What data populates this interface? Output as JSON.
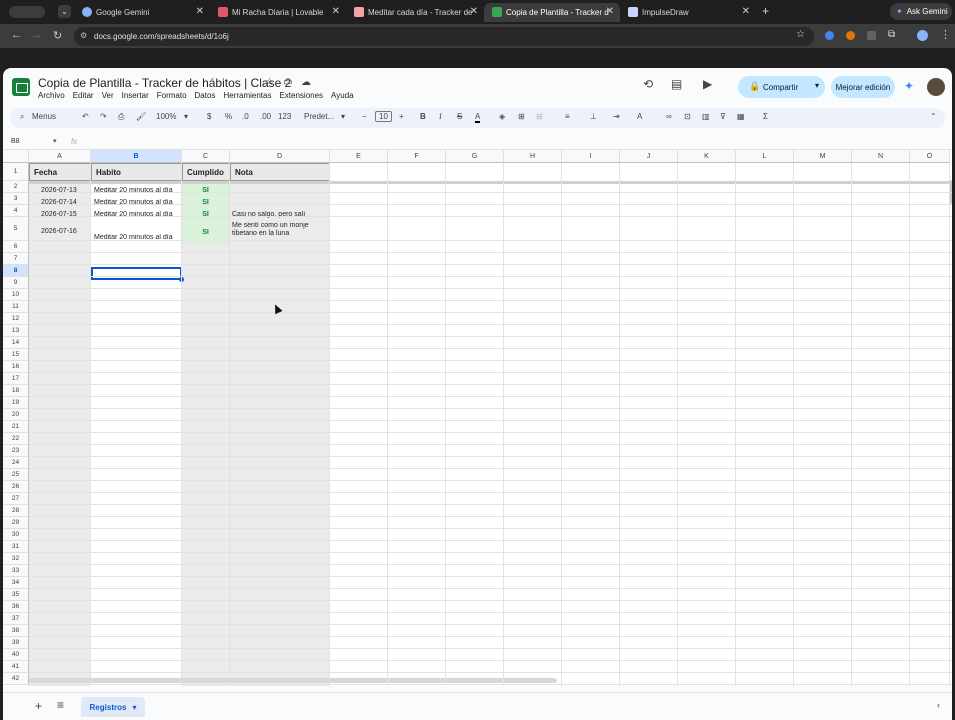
{
  "browser": {
    "tabs": [
      {
        "label": "Google Gemini",
        "color": "#8ab4f8"
      },
      {
        "label": "Mi Racha Diaria | Lovable",
        "color": "#e2566e"
      },
      {
        "label": "Meditar cada día - Tracker de",
        "color": "#f4a3a8"
      },
      {
        "label": "Copia de Plantilla - Tracker d",
        "color": "#34a853"
      },
      {
        "label": "ImpulseDraw",
        "color": "#c9d5ff"
      }
    ],
    "ask_gemini": "Ask Gemini",
    "url": "docs.google.com/spreadsheets/d/1o6j"
  },
  "doc": {
    "title": "Copia de Plantilla - Tracker de hábitos | Clase 2",
    "menu": [
      "Archivo",
      "Editar",
      "Ver",
      "Insertar",
      "Formato",
      "Datos",
      "Herramientas",
      "Extensiones",
      "Ayuda"
    ],
    "share_label": "Compartir",
    "improve_label": "Mejorar edición"
  },
  "toolbar": {
    "menus_label": "Menus",
    "zoom": "100%",
    "currency": "$",
    "percent": "%",
    "dec_minus": ".0",
    "dec_plus": ".00",
    "format_123": "123",
    "font": "Predet...",
    "font_size": "10",
    "bold": "B",
    "italic": "I",
    "strike": "S",
    "text_color": "A"
  },
  "formula": {
    "cell_ref": "B8",
    "fx": "fx"
  },
  "grid": {
    "columns": [
      "A",
      "B",
      "C",
      "D",
      "E",
      "F",
      "G",
      "H",
      "I",
      "J",
      "K",
      "L",
      "M",
      "N",
      "O"
    ],
    "rows": [
      "1",
      "2",
      "3",
      "4",
      "5",
      "6",
      "7",
      "8",
      "9",
      "10",
      "11",
      "12",
      "13",
      "14",
      "15",
      "16",
      "17",
      "18",
      "19",
      "20",
      "21",
      "22",
      "23",
      "24",
      "25",
      "26",
      "27",
      "28",
      "29",
      "30",
      "31",
      "32",
      "33",
      "34",
      "35",
      "36",
      "37",
      "38",
      "39",
      "40",
      "41",
      "42"
    ],
    "selected_cell": "B8",
    "headers": [
      "Fecha",
      "Habito",
      "Cumplido",
      "Nota"
    ],
    "data_rows": [
      {
        "fecha": "2026-07-13",
        "habito": "Meditar 20 minutos al día",
        "cumplido": "SI",
        "nota": ""
      },
      {
        "fecha": "2026-07-14",
        "habito": "Meditar 20 minutos al día",
        "cumplido": "SI",
        "nota": ""
      },
      {
        "fecha": "2026-07-15",
        "habito": "Meditar 20 minutos al día",
        "cumplido": "SI",
        "nota": "Casi no salgo, pero salí"
      },
      {
        "fecha": "2026-07-16",
        "habito": "Meditar 20 minutos al día",
        "cumplido": "SI",
        "nota": "Me sentí como un monje tibetano en la luna"
      }
    ]
  },
  "sheets": {
    "add_icon": "+",
    "list_icon": "≡",
    "active_tab": "Registros"
  }
}
